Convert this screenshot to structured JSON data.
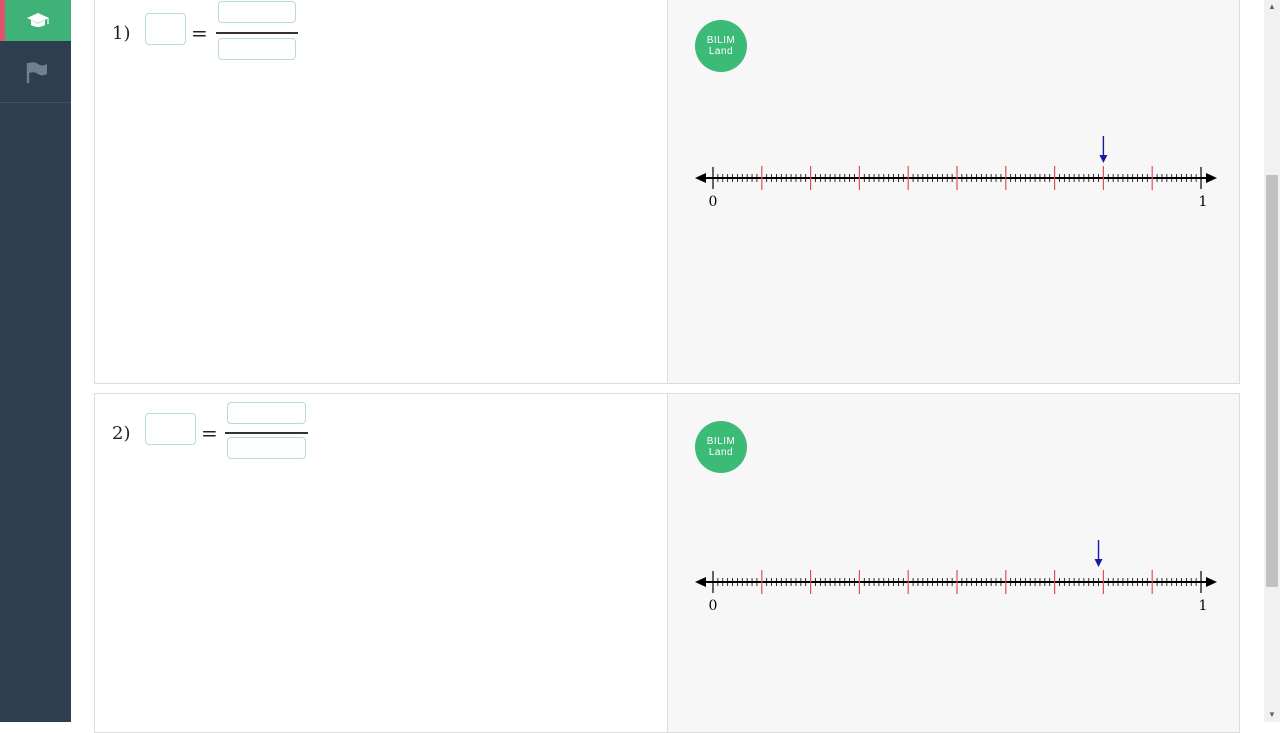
{
  "sidebar": {
    "items": [
      {
        "icon": "graduation-cap-icon",
        "active": true
      },
      {
        "icon": "flag-icon",
        "active": false
      }
    ]
  },
  "exercises": [
    {
      "number": "1)",
      "equals": "=",
      "logo": {
        "line1": "BILIM",
        "line2": "Land"
      },
      "numberline": {
        "start_label": "0",
        "end_label": "1",
        "major_divisions": 10,
        "minor_divisions": 100,
        "arrow_at": 0.8
      }
    },
    {
      "number": "2)",
      "equals": "=",
      "logo": {
        "line1": "BILIM",
        "line2": "Land"
      },
      "numberline": {
        "start_label": "0",
        "end_label": "1",
        "major_divisions": 10,
        "minor_divisions": 100,
        "arrow_at": 0.79
      }
    }
  ],
  "colors": {
    "sidebar": "#2c3e50",
    "accent": "#3fb277",
    "active_marker": "#e0526c",
    "major_tick": "#e0505a",
    "arrow": "#1a1aa0"
  }
}
